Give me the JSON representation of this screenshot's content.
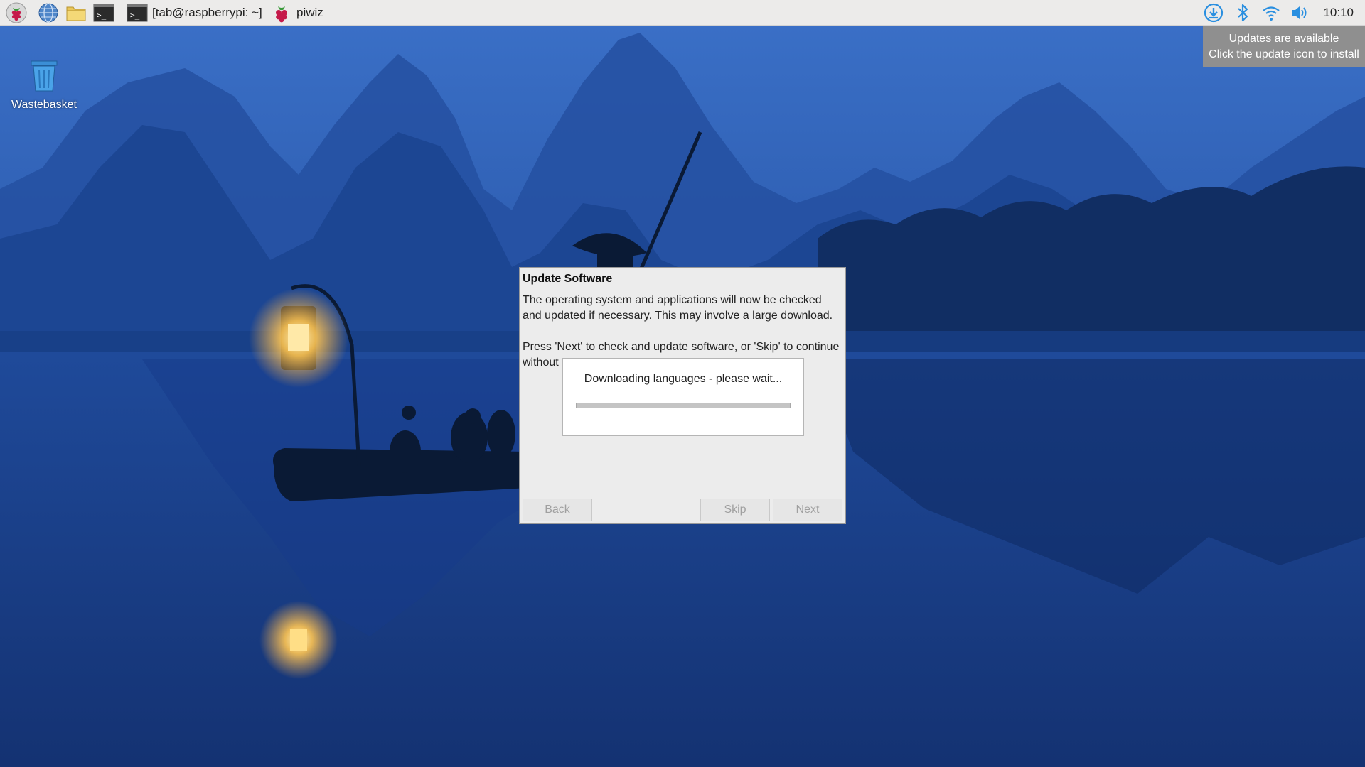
{
  "taskbar": {
    "launchers": [
      {
        "name": "raspberry-menu-icon"
      },
      {
        "name": "web-browser-icon"
      },
      {
        "name": "file-manager-icon"
      },
      {
        "name": "terminal-icon"
      }
    ],
    "tasks": [
      {
        "label": "[tab@raspberrypi: ~]",
        "icon": "terminal-icon"
      },
      {
        "label": "piwiz",
        "icon": "raspberry-icon"
      }
    ],
    "tray": [
      "update-download-icon",
      "bluetooth-icon",
      "wifi-icon",
      "volume-icon"
    ],
    "clock": "10:10"
  },
  "notification": {
    "line1": "Updates are available",
    "line2": "Click the update icon to install"
  },
  "desktop": {
    "icons": [
      {
        "label": "Wastebasket",
        "icon": "wastebasket-icon"
      }
    ]
  },
  "dialog": {
    "title": "Update Software",
    "paragraph1": "The operating system and applications will now be checked and updated if necessary. This may involve a large download.",
    "paragraph2": "Press 'Next' to check and update software, or 'Skip' to continue without",
    "progress": {
      "message": "Downloading languages - please wait...",
      "value": 0
    },
    "buttons": {
      "back": "Back",
      "skip": "Skip",
      "next": "Next"
    }
  },
  "colors": {
    "taskbar_bg": "#ecebea",
    "notification_bg": "#8f8f8f",
    "dialog_bg": "#ececec",
    "raspberry": "#c51a4a"
  }
}
